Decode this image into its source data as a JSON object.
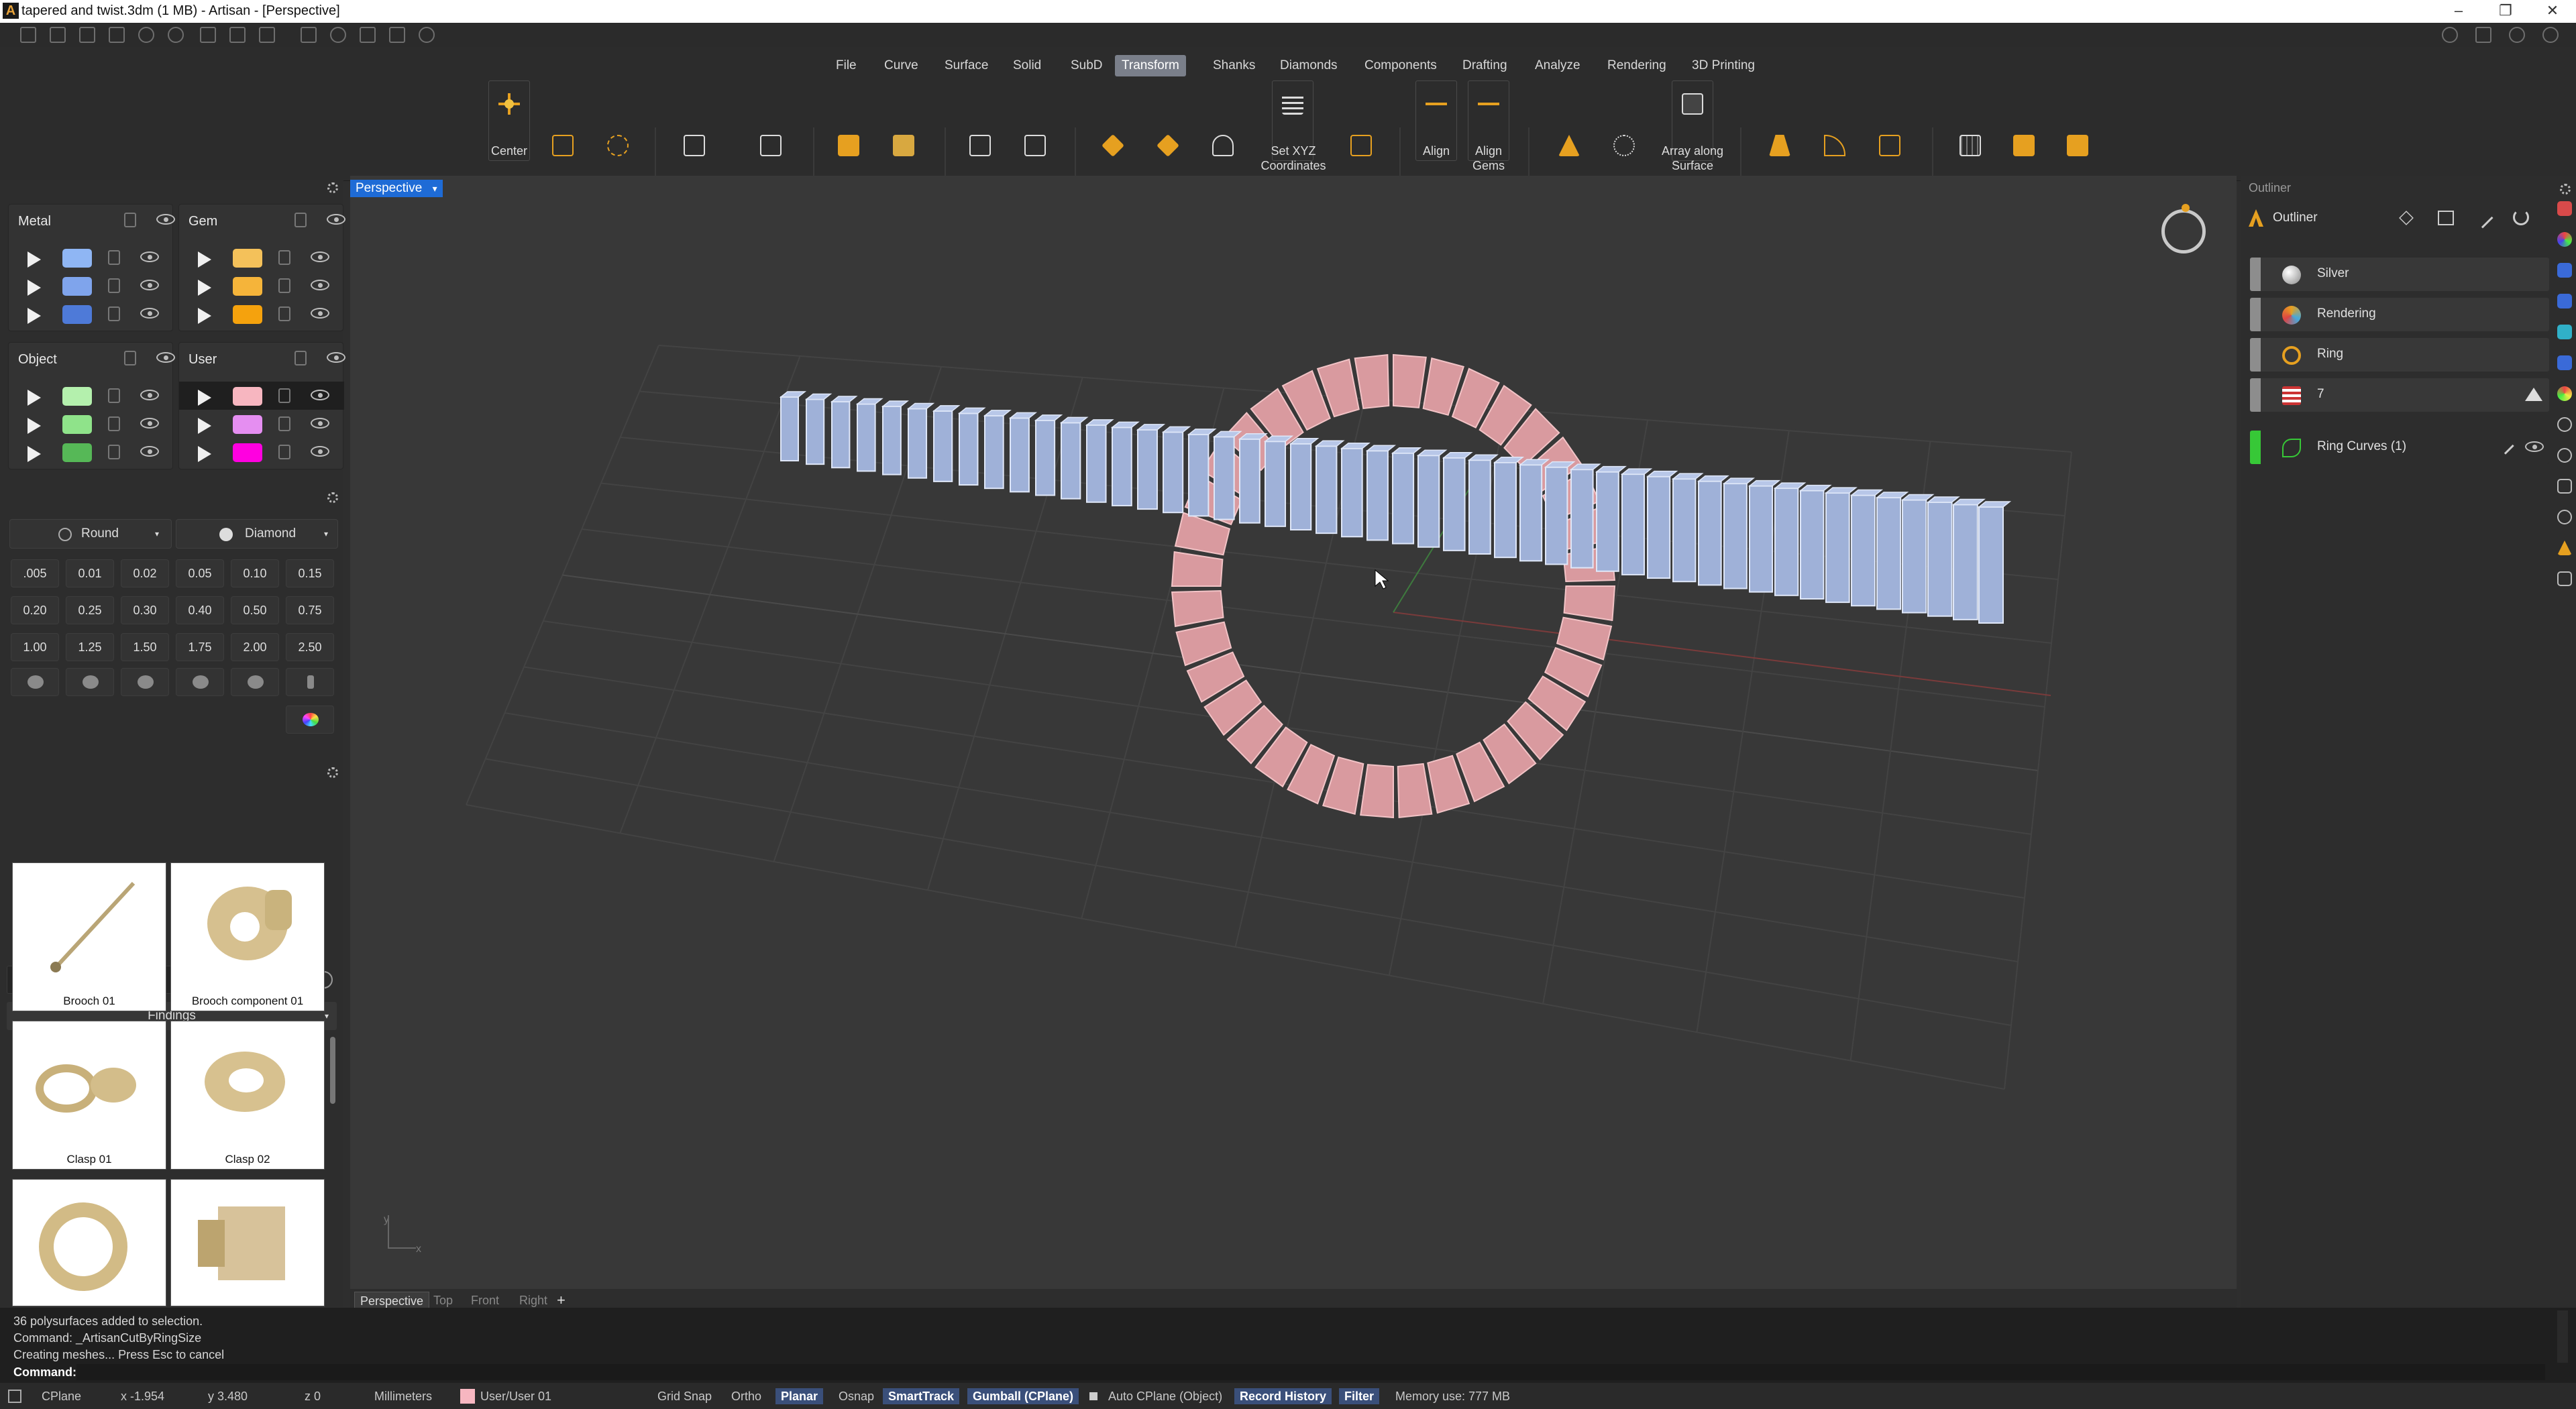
{
  "window": {
    "title": "tapered and twist.3dm (1 MB) - Artisan - [Perspective]",
    "minimize": "–",
    "maximize": "❐",
    "close": "✕"
  },
  "ribbon": {
    "tabs": [
      "File",
      "Curve",
      "Surface",
      "Solid",
      "SubD",
      "Transform",
      "Shanks",
      "Diamonds",
      "Components",
      "Drafting",
      "Analyze",
      "Rendering",
      "3D Printing"
    ],
    "active_tab": "Transform",
    "labels": {
      "center": "Center",
      "set_xyz": "Set XYZ\nCoordinates",
      "align": "Align",
      "align_gems": "Align\nGems",
      "array_along_surface": "Array along\nSurface"
    }
  },
  "layers": {
    "groups": [
      {
        "title": "Metal",
        "colors": [
          "#8fb6f4",
          "#7fa4ec",
          "#4e7ad8"
        ]
      },
      {
        "title": "Gem",
        "colors": [
          "#f4c15a",
          "#f5b43a",
          "#f5a20d"
        ]
      },
      {
        "title": "Object",
        "colors": [
          "#b4f0ad",
          "#8fe38a",
          "#56b857"
        ]
      },
      {
        "title": "User",
        "colors": [
          "#f7b6c0",
          "#e58ef1",
          "#ff00e0"
        ]
      }
    ]
  },
  "gems": {
    "cut": "Round",
    "shape": "Diamond",
    "sizes": [
      ".005",
      "0.01",
      "0.02",
      "0.05",
      "0.10",
      "0.15",
      "0.20",
      "0.25",
      "0.30",
      "0.40",
      "0.50",
      "0.75",
      "1.00",
      "1.25",
      "1.50",
      "1.75",
      "2.00",
      "2.50"
    ]
  },
  "library": {
    "category": "Findings",
    "items": [
      {
        "label": "Brooch 01"
      },
      {
        "label": "Brooch component 01"
      },
      {
        "label": "Clasp 01"
      },
      {
        "label": "Clasp 02"
      },
      {
        "label": ""
      },
      {
        "label": ""
      }
    ]
  },
  "viewport": {
    "label": "Perspective",
    "tabs": [
      "Perspective",
      "Top",
      "Front",
      "Right"
    ],
    "add_tab": "+",
    "axis_y": "y",
    "axis_x": "x"
  },
  "outliner": {
    "panel_title": "Outliner",
    "header_label": "Outliner",
    "rows": [
      {
        "label": "Silver",
        "icon": "silver-ball-icon"
      },
      {
        "label": "Rendering",
        "icon": "palette-icon"
      },
      {
        "label": "Ring",
        "icon": "ring-icon"
      },
      {
        "label": "7",
        "icon": "us-flag-icon"
      },
      {
        "label": "Ring Curves (1)",
        "icon": "curve-icon"
      }
    ]
  },
  "command": {
    "history": [
      "36 polysurfaces added to selection.",
      "Command: _ArtisanCutByRingSize",
      "Creating meshes... Press Esc to cancel"
    ],
    "prompt": "Command:"
  },
  "statusbar": {
    "cplane": "CPlane",
    "x": "x -1.954",
    "y": "y 3.480",
    "z": "z 0",
    "units": "Millimeters",
    "layer": "User/User 01",
    "layer_color": "#f7b6c0",
    "toggles": [
      {
        "label": "Grid Snap",
        "on": false
      },
      {
        "label": "Ortho",
        "on": false
      },
      {
        "label": "Planar",
        "on": true
      },
      {
        "label": "Osnap",
        "on": false
      },
      {
        "label": "SmartTrack",
        "on": true
      },
      {
        "label": "Gumball (CPlane)",
        "on": true
      },
      {
        "label": "Auto CPlane (Object)",
        "on": false
      },
      {
        "label": "Record History",
        "on": true
      },
      {
        "label": "Filter",
        "on": true
      }
    ],
    "memory": "Memory use: 777 MB"
  },
  "colors": {
    "accent": "#1e6bd6",
    "active_tab": "#7a7f8a",
    "metal_blue": "#9fb4e0",
    "user_pink": "#e8a0a6"
  }
}
